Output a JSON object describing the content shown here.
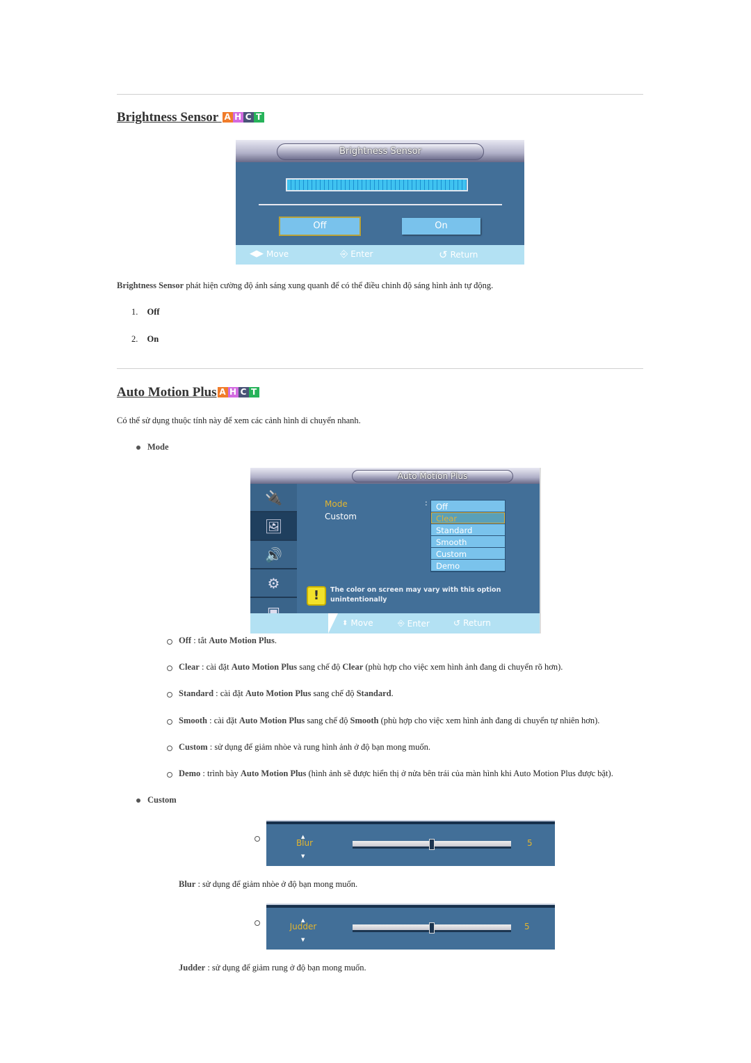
{
  "badge": {
    "letters": [
      "A",
      "H",
      "C",
      "T"
    ],
    "colors": [
      "#f07c2a",
      "#d26ae0",
      "#4a5478",
      "#27b35a"
    ]
  },
  "brightness": {
    "heading": "Brightness Sensor",
    "osd": {
      "title": "Brightness Sensor",
      "off": "Off",
      "on": "On",
      "selected": "Off",
      "footer": {
        "move": "Move",
        "enter": "Enter",
        "return": "Return"
      }
    },
    "description": [
      {
        "t": "Brightness Sensor",
        "b": true
      },
      {
        "t": " phát hiện cường độ ánh sáng xung quanh để có thể điều chinh độ sáng hình ảnh tự động.",
        "b": false
      }
    ],
    "list": [
      {
        "num": "1.",
        "label": "Off"
      },
      {
        "num": "2.",
        "label": "On"
      }
    ]
  },
  "amp": {
    "heading": "Auto Motion Plus",
    "intro": "Có thể sử dụng thuộc tính này để xem các cảnh hình di chuyển nhanh.",
    "mode_label": "Mode",
    "osd": {
      "title": "Auto Motion Plus",
      "menu": [
        "Mode",
        "Custom"
      ],
      "colon": ":",
      "options": [
        "Off",
        "Clear",
        "Standard",
        "Smooth",
        "Custom",
        "Demo"
      ],
      "selected": "Clear",
      "warning": [
        "The color on screen may vary with this option",
        "unintentionally"
      ],
      "footer": {
        "move": "Move",
        "enter": "Enter",
        "return": "Return"
      }
    },
    "items": [
      [
        {
          "t": "Off",
          "b": true
        },
        {
          "t": " : tắt ",
          "b": false
        },
        {
          "t": "Auto Motion Plus",
          "b": true
        },
        {
          "t": ".",
          "b": false
        }
      ],
      [
        {
          "t": "Clear",
          "b": true
        },
        {
          "t": " : cài đặt ",
          "b": false
        },
        {
          "t": "Auto Motion Plus",
          "b": true
        },
        {
          "t": " sang chế độ ",
          "b": false
        },
        {
          "t": "Clear",
          "b": true
        },
        {
          "t": " (phù hợp cho việc xem hình ảnh đang di chuyển rõ hơn).",
          "b": false
        }
      ],
      [
        {
          "t": "Standard",
          "b": true
        },
        {
          "t": " : cài đặt ",
          "b": false
        },
        {
          "t": "Auto Motion Plus",
          "b": true
        },
        {
          "t": " sang chế độ ",
          "b": false
        },
        {
          "t": "Standard",
          "b": true
        },
        {
          "t": ".",
          "b": false
        }
      ],
      [
        {
          "t": "Smooth",
          "b": true
        },
        {
          "t": " : cài đặt ",
          "b": false
        },
        {
          "t": "Auto Motion Plus",
          "b": true
        },
        {
          "t": " sang chế độ ",
          "b": false
        },
        {
          "t": "Smooth",
          "b": true
        },
        {
          "t": " (phù hợp cho việc xem hình ảnh đang di chuyển tự nhiên hơn).",
          "b": false
        }
      ],
      [
        {
          "t": "Custom",
          "b": true
        },
        {
          "t": " : sử dụng để giảm nhòe và rung hình ảnh ở độ bạn mong muốn.",
          "b": false
        }
      ],
      [
        {
          "t": "Demo",
          "b": true
        },
        {
          "t": " : trình bày ",
          "b": false
        },
        {
          "t": "Auto Motion Plus",
          "b": true
        },
        {
          "t": " (hình ảnh sẽ được hiển thị ở nửa bên trái của màn hình khi Auto Motion Plus được bật).",
          "b": false
        }
      ]
    ],
    "custom_label": "Custom",
    "blur": {
      "label": "Blur",
      "value": "5",
      "level": 0.5,
      "desc": [
        {
          "t": "Blur",
          "b": true
        },
        {
          "t": " : sử dụng để giảm nhòe ở độ bạn mong muốn.",
          "b": false
        }
      ]
    },
    "judder": {
      "label": "Judder",
      "value": "5",
      "level": 0.5,
      "desc": [
        {
          "t": "Judder",
          "b": true
        },
        {
          "t": " : sử dụng để giảm rung ở độ bạn mong muốn.",
          "b": false
        }
      ]
    }
  }
}
